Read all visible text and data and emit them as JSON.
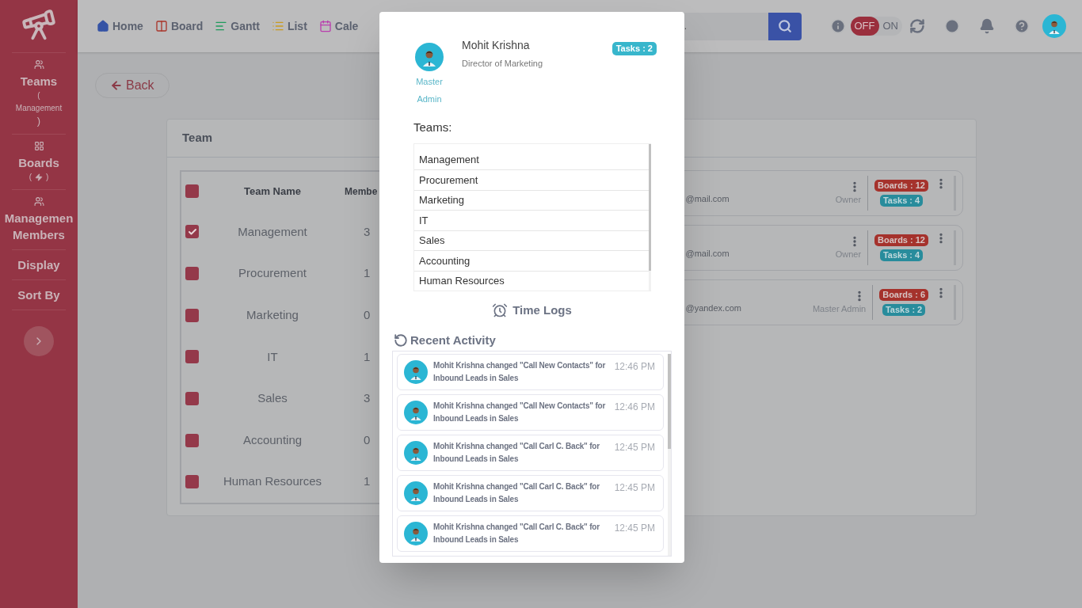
{
  "sidebar": {
    "items": [
      {
        "kind": "teams",
        "label": "Teams",
        "open": "(",
        "sub": "Management",
        "close": ")"
      },
      {
        "kind": "boards",
        "label": "Boards",
        "open": "(",
        "close": ")"
      },
      {
        "kind": "members",
        "label": "Managemen Members"
      },
      {
        "kind": "plain",
        "label": "Display"
      },
      {
        "kind": "plain",
        "label": "Sort By"
      }
    ]
  },
  "nav": [
    {
      "kind": "home",
      "label": "Home"
    },
    {
      "kind": "board",
      "label": "Board"
    },
    {
      "kind": "gantt",
      "label": "Gantt"
    },
    {
      "kind": "list",
      "label": "List"
    },
    {
      "kind": "calendar",
      "label": "Cale"
    }
  ],
  "search": {
    "placeholder": ".."
  },
  "toggle": [
    {
      "label": "OFF",
      "selected": true
    },
    {
      "label": "ON",
      "selected": false
    }
  ],
  "back_button": "Back",
  "team_card": {
    "title": "Team",
    "table": {
      "all_checked": false,
      "columns": [
        "Team Name",
        "Membe"
      ],
      "rows": [
        {
          "name": "Management",
          "members": "3",
          "checked": true
        },
        {
          "name": "Procurement",
          "members": "1",
          "checked": false
        },
        {
          "name": "Marketing",
          "members": "0",
          "checked": false
        },
        {
          "name": "IT",
          "members": "1",
          "checked": false
        },
        {
          "name": "Sales",
          "members": "3",
          "checked": false
        },
        {
          "name": "Accounting",
          "members": "0",
          "checked": false
        },
        {
          "name": "Human Resources",
          "members": "1",
          "checked": false
        }
      ]
    },
    "members": [
      {
        "email": "@mail.com",
        "role": "Owner",
        "boards": "Boards : 12",
        "tasks": "Tasks : 4"
      },
      {
        "email": "@mail.com",
        "role": "Owner",
        "boards": "Boards : 12",
        "tasks": "Tasks : 4"
      },
      {
        "email": "@yandex.com",
        "role": "Master Admin",
        "boards": "Boards : 6",
        "tasks": "Tasks : 2"
      }
    ]
  },
  "profile": {
    "name": "Mohit Krishna",
    "title": "Director of Marketing",
    "role": "Master Admin",
    "tasks": "Tasks : 2",
    "teams_label": "Teams:",
    "teams": [
      "Management",
      "Procurement",
      "Marketing",
      "IT",
      "Sales",
      "Accounting",
      "Human Resources"
    ],
    "time_logs": "Time Logs",
    "recent_label": "Recent Activity",
    "activity": [
      {
        "text": "Mohit Krishna changed \"Call New Contacts\" for Inbound Leads in Sales",
        "time": "12:46 PM"
      },
      {
        "text": "Mohit Krishna changed \"Call New Contacts\" for Inbound Leads in Sales",
        "time": "12:46 PM"
      },
      {
        "text": "Mohit Krishna changed \"Call Carl C. Back\" for Inbound Leads in Sales",
        "time": "12:45 PM"
      },
      {
        "text": "Mohit Krishna changed \"Call Carl C. Back\" for Inbound Leads in Sales",
        "time": "12:45 PM"
      },
      {
        "text": "Mohit Krishna changed \"Call Carl C. Back\" for Inbound Leads in Sales",
        "time": "12:45 PM"
      }
    ]
  }
}
